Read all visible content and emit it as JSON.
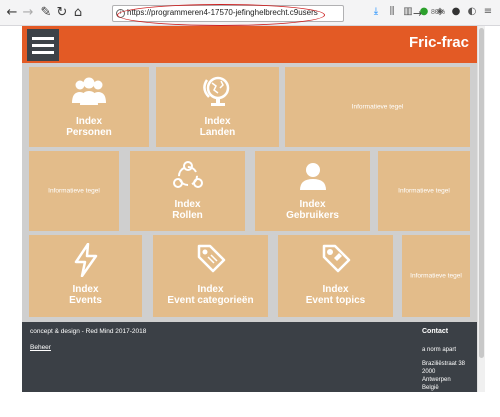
{
  "browser": {
    "url": "https://programmeren4-17570-jefinghelbrecht.c9users",
    "zoom": "80%",
    "back_icon": "arrow-left-icon",
    "forward_icon": "arrow-right-icon",
    "tools_icon": "wrench-icon",
    "reload_icon": "reload-icon",
    "home_icon": "home-icon"
  },
  "header": {
    "brand": "Fric-frac",
    "bg_color": "#e35a25"
  },
  "tiles": {
    "personen": {
      "line1": "Index",
      "line2": "Personen",
      "icon": "people-icon"
    },
    "landen": {
      "line1": "Index",
      "line2": "Landen",
      "icon": "globe-icon"
    },
    "info1": "Informatieve tegel",
    "info2": "Informatieve tegel",
    "rollen": {
      "line1": "Index",
      "line2": "Rollen",
      "icon": "network-icon"
    },
    "gebruikers": {
      "line1": "Index",
      "line2": "Gebruikers",
      "icon": "user-icon"
    },
    "info3": "Informatieve tegel",
    "events": {
      "line1": "Index",
      "line2": "Events",
      "icon": "lightning-icon"
    },
    "categorieen": {
      "line1": "Index",
      "line2": "Event categorieën",
      "icon": "tag-icon"
    },
    "topics": {
      "line1": "Index",
      "line2": "Event topics",
      "icon": "tag-diamond-icon"
    },
    "info4": "Informatieve tegel",
    "tile_color": "#e3bc8a"
  },
  "footer": {
    "credit": "concept & design - Red Mind 2017-2018",
    "beheer": "Beheer",
    "contact_title": "Contact",
    "company": "a norm apart",
    "street": "Braziliëstraat 38",
    "postcode": "2000",
    "city": "Antwerpen",
    "country": "België"
  }
}
